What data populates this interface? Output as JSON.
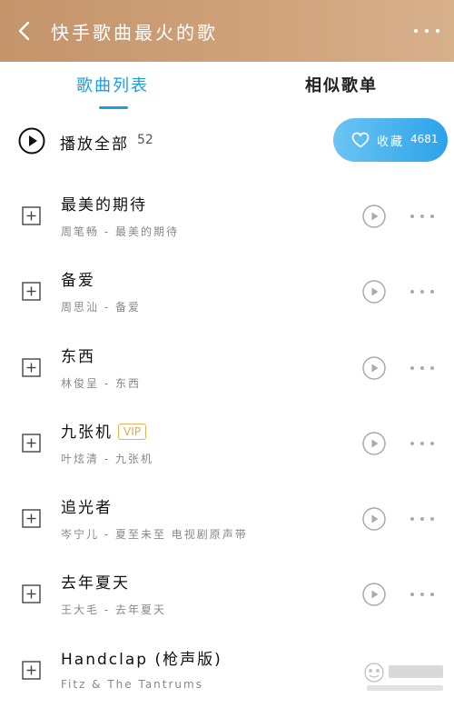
{
  "header": {
    "title": "快手歌曲最火的歌"
  },
  "tabs": [
    {
      "label": "歌曲列表",
      "active": true
    },
    {
      "label": "相似歌单",
      "active": false
    }
  ],
  "play_all": {
    "label": "播放全部",
    "count": "52"
  },
  "collect": {
    "label": "收藏",
    "count": "4681"
  },
  "songs": [
    {
      "title": "最美的期待",
      "subtitle": "周笔畅 - 最美的期待"
    },
    {
      "title": "备爱",
      "subtitle": "周思汕 - 备爱"
    },
    {
      "title": "东西",
      "subtitle": "林俊呈 - 东西"
    },
    {
      "title": "九张机",
      "subtitle": "叶炫清 - 九张机",
      "badge": "VIP"
    },
    {
      "title": "追光者",
      "subtitle": "岑宁儿 - 夏至未至 电视剧原声带"
    },
    {
      "title": "去年夏天",
      "subtitle": "王大毛 - 去年夏天"
    },
    {
      "title": "Handclap (枪声版)",
      "subtitle": "Fitz & The Tantrums"
    }
  ],
  "colors": {
    "accent": "#1a9ee0",
    "header": "#c9996f",
    "vip": "#e0a84a"
  },
  "icons": [
    "back-icon",
    "more-icon",
    "play-all-icon",
    "heart-icon",
    "add-icon",
    "play-icon",
    "dots-icon"
  ]
}
